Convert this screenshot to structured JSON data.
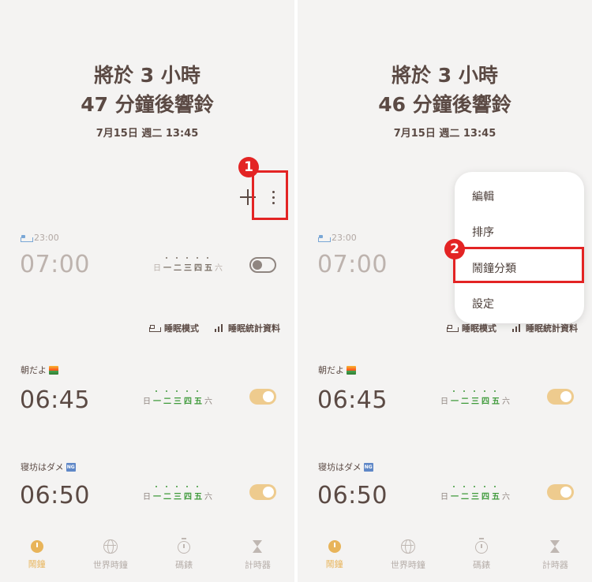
{
  "screens": [
    {
      "headline_line1": "將於 3 小時",
      "headline_line2": "47 分鐘後響鈴",
      "date": "7月15日 週二 13:45"
    },
    {
      "headline_line1": "將於 3 小時",
      "headline_line2": "46 分鐘後響鈴",
      "date": "7月15日 週二 13:45"
    }
  ],
  "alarms": [
    {
      "label": "23:00",
      "time": "07:00",
      "enabled": false
    },
    {
      "label": "朝だよ",
      "time": "06:45",
      "enabled": true
    },
    {
      "label": "寝坊はダメ",
      "time": "06:50",
      "enabled": true
    }
  ],
  "weekdays": [
    "日",
    "一",
    "二",
    "三",
    "四",
    "五",
    "六"
  ],
  "sleep_links": {
    "sleep_mode": "睡眠模式",
    "sleep_stats": "睡眠統計資料"
  },
  "nav": {
    "alarm": "鬧鐘",
    "world_clock": "世界時鐘",
    "stopwatch": "碼錶",
    "timer": "計時器"
  },
  "menu": {
    "edit": "編輯",
    "sort": "排序",
    "categories": "鬧鐘分類",
    "settings": "設定"
  },
  "callouts": {
    "step1": "1",
    "step2": "2"
  },
  "colors": {
    "text": "#5b4a44",
    "active_accent": "#e8b45a",
    "toggle_on": "#eecb8e",
    "weekday_on": "#3f9a3b",
    "callout": "#e32424",
    "background": "#f4f3f2"
  }
}
